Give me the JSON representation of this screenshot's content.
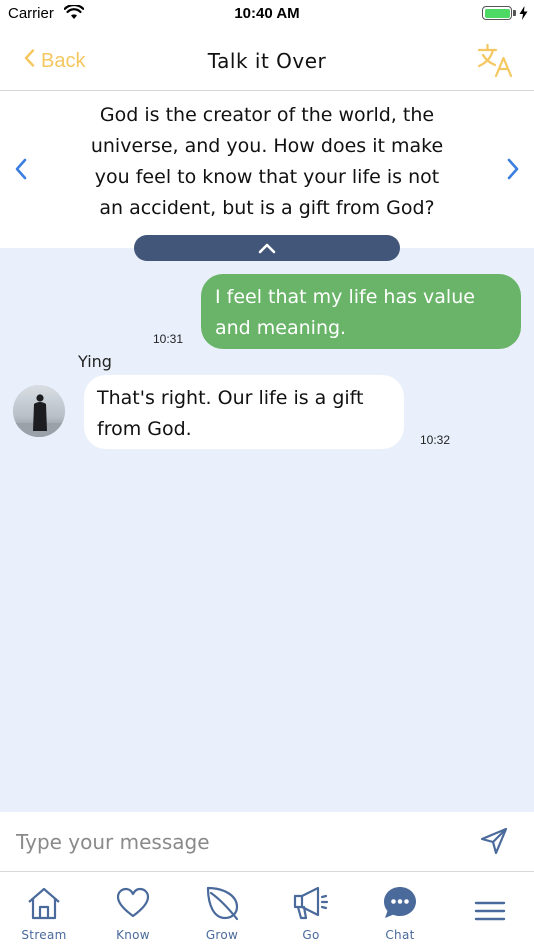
{
  "status_bar": {
    "carrier": "Carrier",
    "time": "10:40 AM",
    "battery_level": 1.0
  },
  "nav": {
    "back_label": "Back",
    "title": "Talk it Over",
    "translate_icon": "translate-icon"
  },
  "question": {
    "text": "God is the creator of the world, the universe, and you. How does it make you feel to know that your life is not an accident, but is a gift from God?"
  },
  "messages": [
    {
      "direction": "outgoing",
      "text": "I feel that my life has value and meaning.",
      "time": "10:31"
    },
    {
      "direction": "incoming",
      "sender": "Ying",
      "text": "That's right. Our life is a gift from God.",
      "time": "10:32"
    }
  ],
  "composer": {
    "placeholder": "Type your message"
  },
  "tabs": [
    {
      "label": "Stream",
      "icon": "home-icon"
    },
    {
      "label": "Know",
      "icon": "heart-icon"
    },
    {
      "label": "Grow",
      "icon": "leaf-icon"
    },
    {
      "label": "Go",
      "icon": "megaphone-icon"
    },
    {
      "label": "Chat",
      "icon": "chat-icon"
    },
    {
      "label": "",
      "icon": "menu-icon"
    }
  ],
  "colors": {
    "accent": "#f4c760",
    "nav_arrow": "#3a7ee0",
    "chat_bg": "#e9f0fc",
    "outgoing_bubble": "#69b468",
    "handle": "#415679",
    "tab_icon": "#4a6a9b"
  }
}
